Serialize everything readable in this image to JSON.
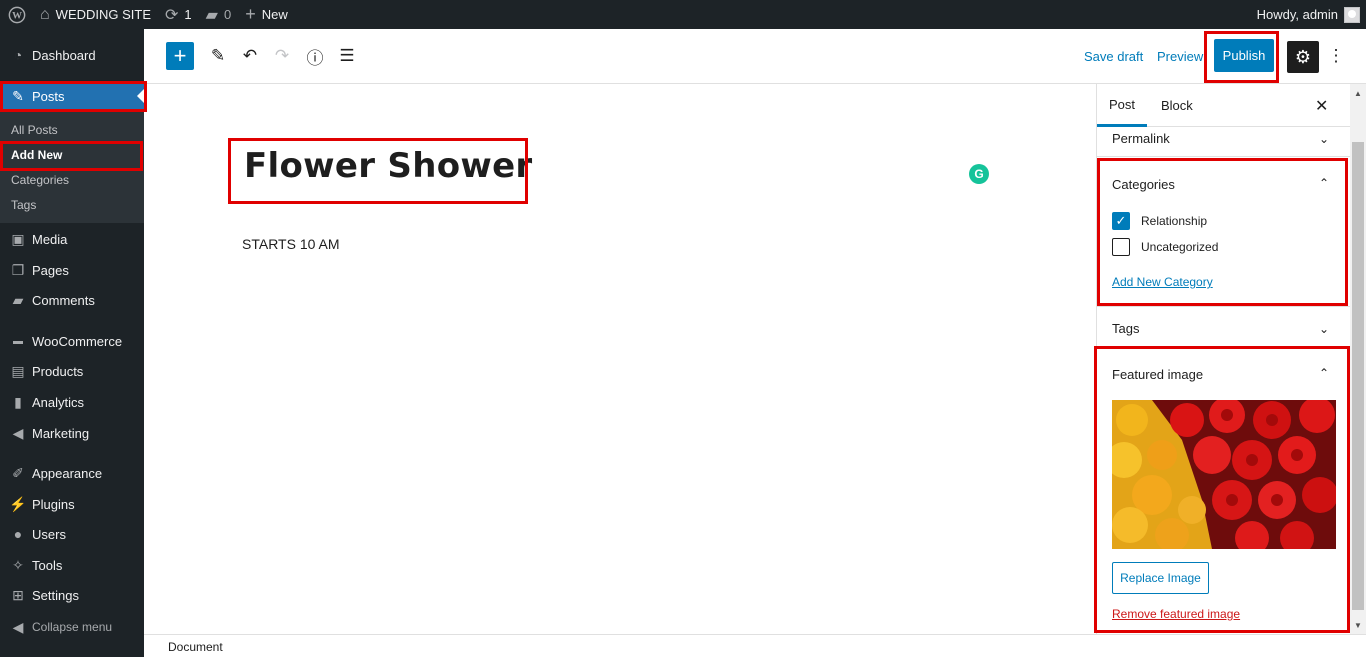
{
  "admin_bar": {
    "site_name": "WEDDING SITE",
    "updates_count": "1",
    "comments_count": "0",
    "new_label": "New",
    "greeting": "Howdy, admin"
  },
  "sidebar": {
    "items": [
      {
        "label": "Dashboard",
        "icon": "dashboard-icon"
      },
      {
        "label": "Posts",
        "icon": "pin-icon"
      },
      {
        "label": "Media",
        "icon": "media-icon"
      },
      {
        "label": "Pages",
        "icon": "pages-icon"
      },
      {
        "label": "Comments",
        "icon": "comments-icon"
      },
      {
        "label": "WooCommerce",
        "icon": "woocommerce-icon"
      },
      {
        "label": "Products",
        "icon": "products-icon"
      },
      {
        "label": "Analytics",
        "icon": "analytics-icon"
      },
      {
        "label": "Marketing",
        "icon": "marketing-icon"
      },
      {
        "label": "Appearance",
        "icon": "appearance-icon"
      },
      {
        "label": "Plugins",
        "icon": "plugins-icon"
      },
      {
        "label": "Users",
        "icon": "users-icon"
      },
      {
        "label": "Tools",
        "icon": "tools-icon"
      },
      {
        "label": "Settings",
        "icon": "settings-icon"
      }
    ],
    "submenu": [
      "All Posts",
      "Add New",
      "Categories",
      "Tags"
    ],
    "collapse_label": "Collapse menu"
  },
  "toolbar": {
    "save_draft": "Save draft",
    "preview": "Preview",
    "publish": "Publish"
  },
  "post": {
    "title": "Flower Shower",
    "paragraph": "STARTS 10 AM"
  },
  "panel": {
    "tabs": [
      "Post",
      "Block"
    ],
    "permalink": "Permalink",
    "categories_title": "Categories",
    "categories": [
      {
        "label": "Relationship",
        "checked": true
      },
      {
        "label": "Uncategorized",
        "checked": false
      }
    ],
    "add_new_category": "Add New Category",
    "tags_title": "Tags",
    "featured_title": "Featured image",
    "replace_image": "Replace Image",
    "remove_image": "Remove featured image"
  },
  "footer": {
    "label": "Document"
  },
  "colors": {
    "admin_dark": "#1d2327",
    "accent": "#007cba",
    "highlight": "#e00000"
  }
}
